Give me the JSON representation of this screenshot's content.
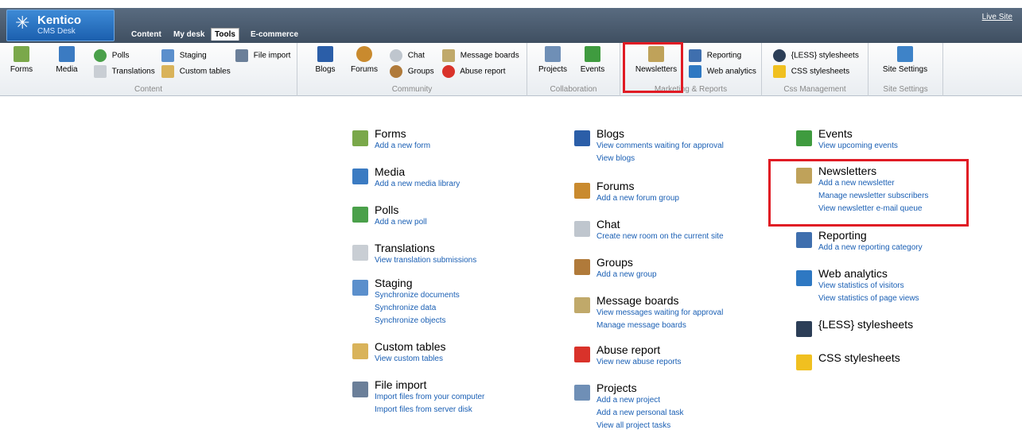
{
  "header": {
    "brand": "Kentico",
    "brand_sub": "CMS Desk",
    "tabs": [
      "Content",
      "My desk",
      "Tools",
      "E-commerce"
    ],
    "live_site": "Live Site"
  },
  "ribbon": {
    "content": {
      "label": "Content",
      "forms": "Forms",
      "media": "Media",
      "polls": "Polls",
      "translations": "Translations",
      "staging": "Staging",
      "custom_tables": "Custom tables",
      "file_import": "File import"
    },
    "community": {
      "label": "Community",
      "blogs": "Blogs",
      "forums": "Forums",
      "chat": "Chat",
      "groups": "Groups",
      "message_boards": "Message boards",
      "abuse_report": "Abuse report"
    },
    "collaboration": {
      "label": "Collaboration",
      "projects": "Projects",
      "events": "Events"
    },
    "marketing": {
      "label": "Marketing & Reports",
      "newsletters": "Newsletters",
      "reporting": "Reporting",
      "web_analytics": "Web analytics"
    },
    "css": {
      "label": "Css Management",
      "less": "{LESS} stylesheets",
      "css": "CSS stylesheets"
    },
    "site": {
      "label": "Site Settings",
      "site_settings": "Site Settings"
    }
  },
  "col1": [
    {
      "title": "Forms",
      "links": [
        "Add a new form"
      ],
      "icon": "forms-icon"
    },
    {
      "title": "Media",
      "links": [
        "Add a new media library"
      ],
      "icon": "media-icon"
    },
    {
      "title": "Polls",
      "links": [
        "Add a new poll"
      ],
      "icon": "polls-icon"
    },
    {
      "title": "Translations",
      "links": [
        "View translation submissions"
      ],
      "icon": "translations-icon"
    },
    {
      "title": "Staging",
      "links": [
        "Synchronize documents",
        "Synchronize data",
        "Synchronize objects"
      ],
      "icon": "staging-icon"
    },
    {
      "title": "Custom tables",
      "links": [
        "View custom tables"
      ],
      "icon": "custom-tables-icon"
    },
    {
      "title": "File import",
      "links": [
        "Import files from your computer",
        "Import files from server disk"
      ],
      "icon": "file-import-icon"
    }
  ],
  "col2": [
    {
      "title": "Blogs",
      "links": [
        "View comments waiting for approval",
        "View blogs"
      ],
      "icon": "blogs-icon"
    },
    {
      "title": "Forums",
      "links": [
        "Add a new forum group"
      ],
      "icon": "forums-icon"
    },
    {
      "title": "Chat",
      "links": [
        "Create new room on the current site"
      ],
      "icon": "chat-icon"
    },
    {
      "title": "Groups",
      "links": [
        "Add a new group"
      ],
      "icon": "groups-icon"
    },
    {
      "title": "Message boards",
      "links": [
        "View messages waiting for approval",
        "Manage message boards"
      ],
      "icon": "message-boards-icon"
    },
    {
      "title": "Abuse report",
      "links": [
        "View new abuse reports"
      ],
      "icon": "abuse-report-icon"
    },
    {
      "title": "Projects",
      "links": [
        "Add a new project",
        "Add a new personal task",
        "View all project tasks"
      ],
      "icon": "projects-icon"
    }
  ],
  "col3": [
    {
      "title": "Events",
      "links": [
        "View upcoming events"
      ],
      "icon": "events-icon"
    },
    {
      "title": "Newsletters",
      "links": [
        "Add a new newsletter",
        "Manage newsletter subscribers",
        "View newsletter e-mail queue"
      ],
      "icon": "newsletters-icon"
    },
    {
      "title": "Reporting",
      "links": [
        "Add a new reporting category"
      ],
      "icon": "reporting-icon"
    },
    {
      "title": "Web analytics",
      "links": [
        "View statistics of visitors",
        "View statistics of page views"
      ],
      "icon": "web-analytics-icon"
    },
    {
      "title": "{LESS} stylesheets",
      "links": [],
      "icon": "less-icon"
    },
    {
      "title": "CSS stylesheets",
      "links": [],
      "icon": "css-icon"
    }
  ],
  "colors": {
    "link": "#1a5fb4",
    "highlight": "#e01b24",
    "header": "#4a5a6c"
  }
}
